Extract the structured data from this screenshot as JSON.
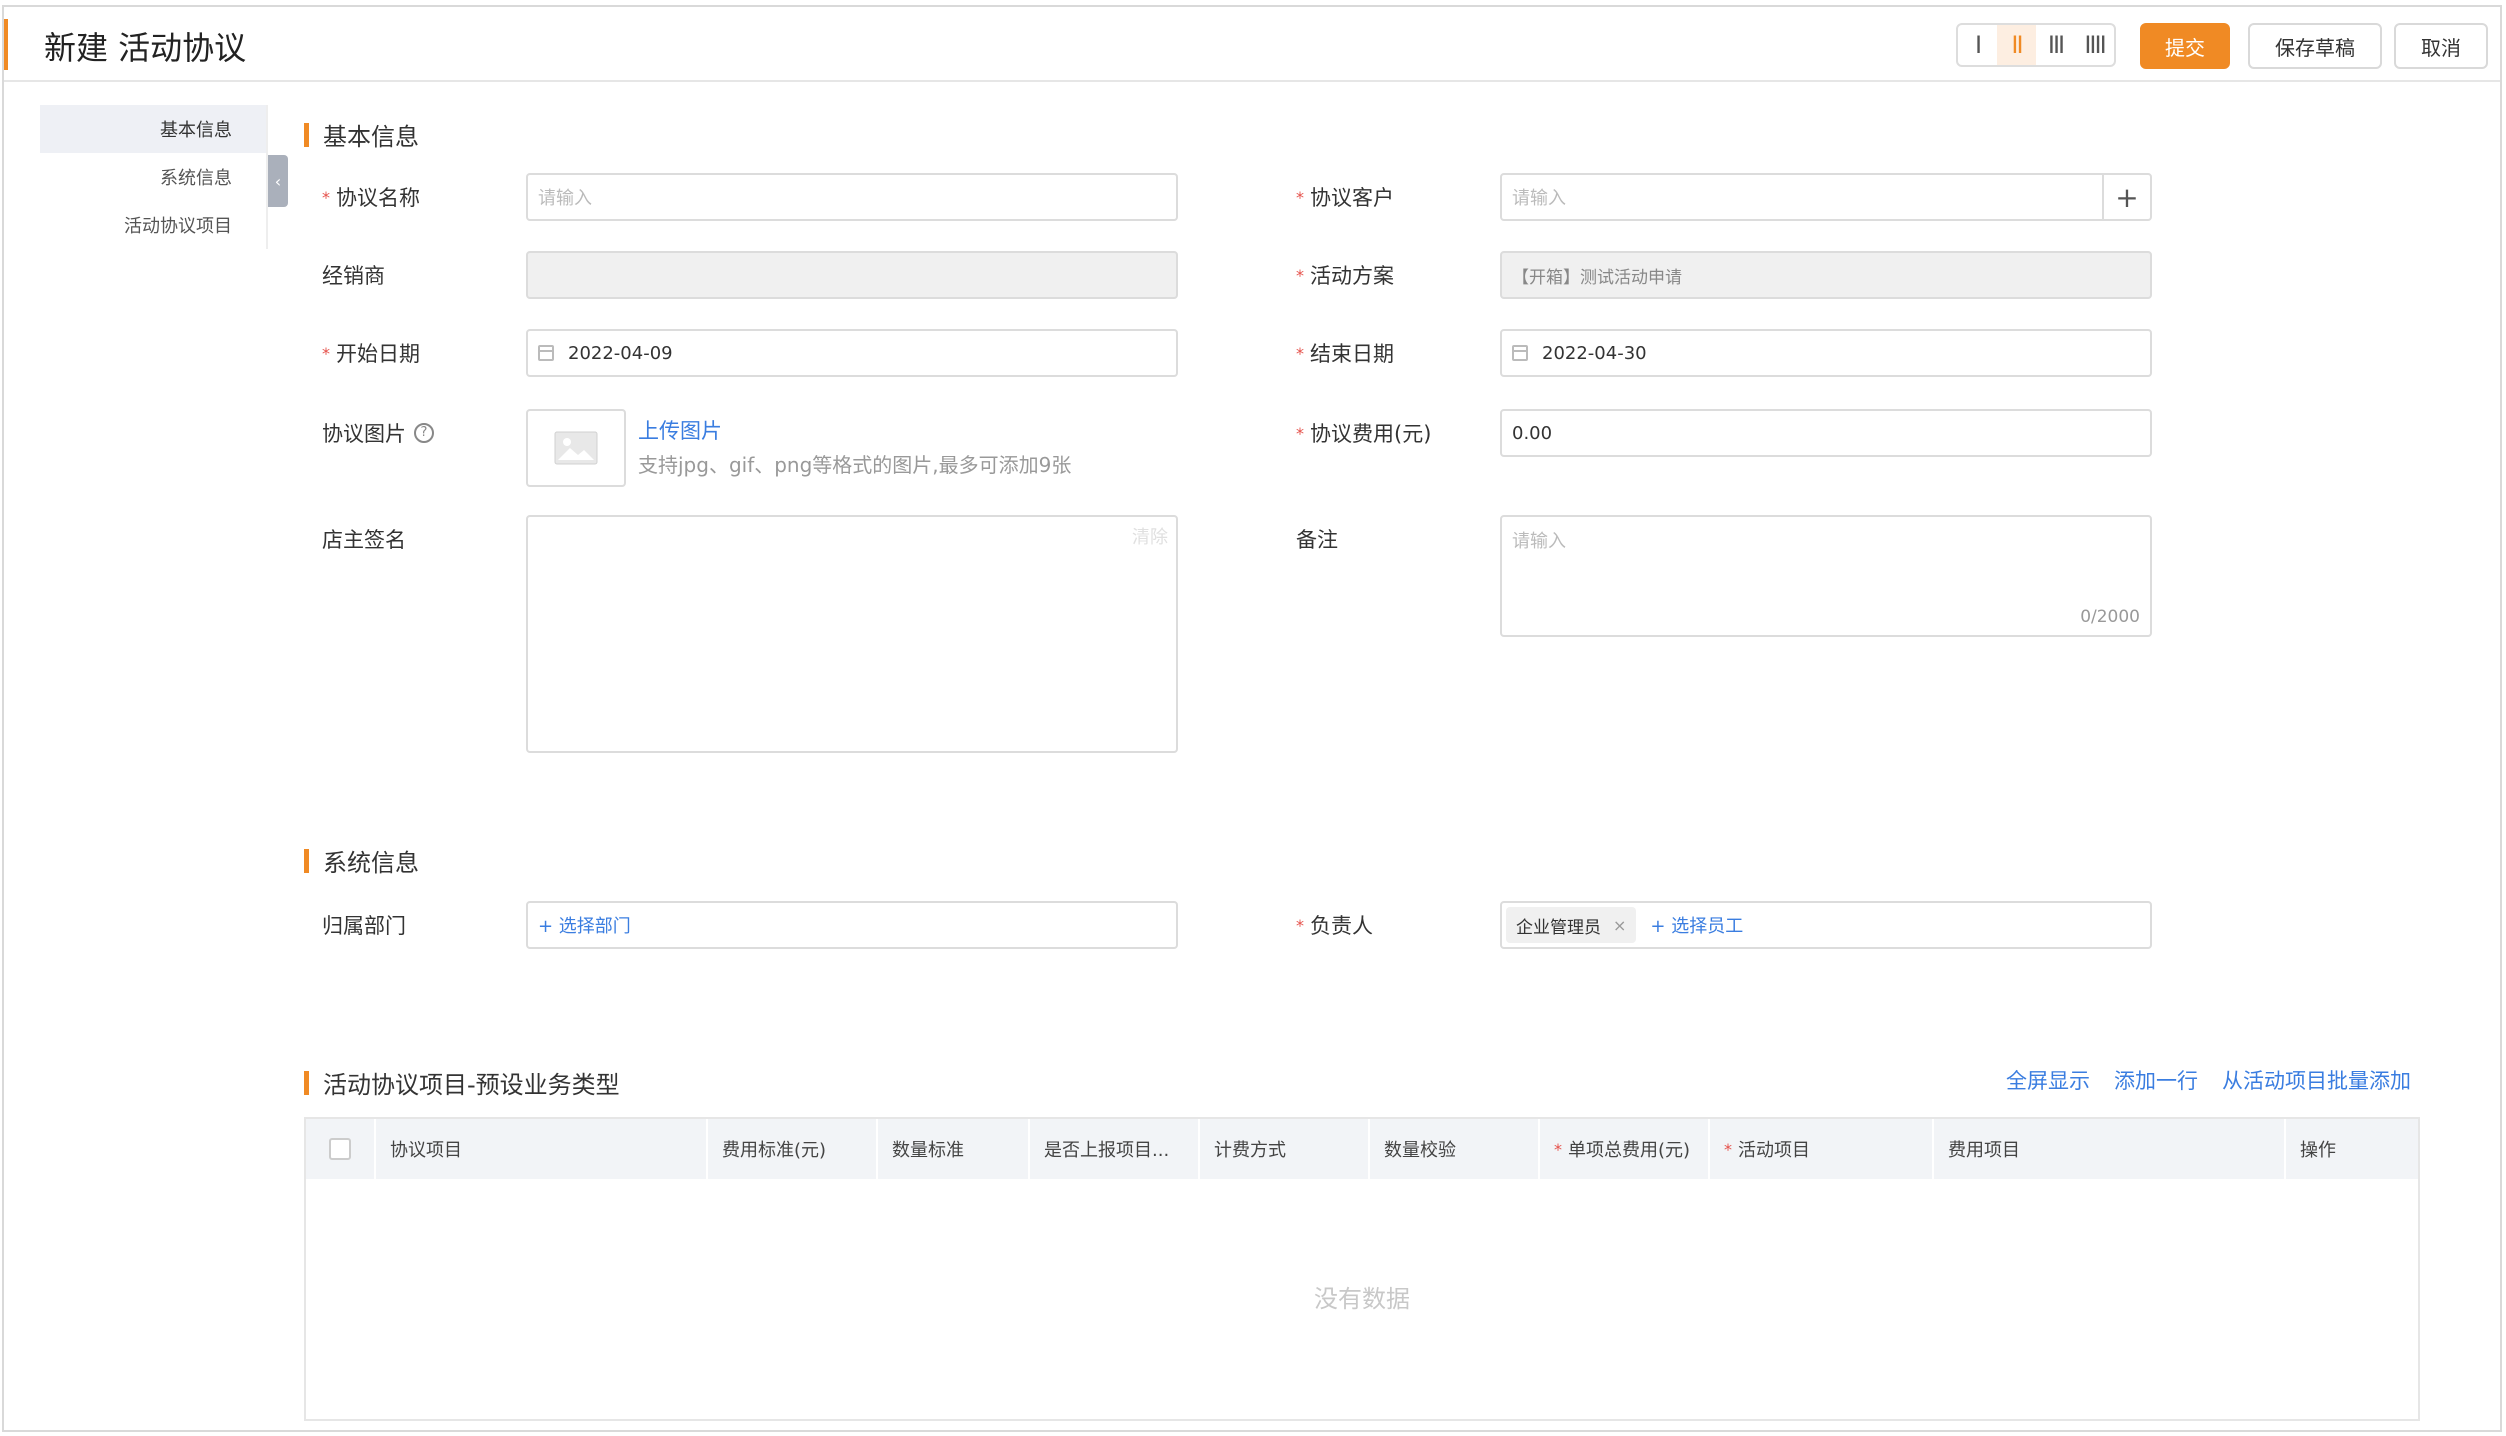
{
  "header": {
    "title": "新建 活动协议",
    "layout_options": [
      "I",
      "II",
      "III",
      "IIII"
    ],
    "submit_label": "提交",
    "save_draft_label": "保存草稿",
    "cancel_label": "取消",
    "accent_color": "#f08a24"
  },
  "sidenav": {
    "items": [
      {
        "label": "基本信息",
        "active": true
      },
      {
        "label": "系统信息",
        "active": false
      },
      {
        "label": "活动协议项目",
        "active": false
      }
    ]
  },
  "basic": {
    "section_title": "基本信息",
    "name_label": "协议名称",
    "name_placeholder": "请输入",
    "customer_label": "协议客户",
    "customer_placeholder": "请输入",
    "dealer_label": "经销商",
    "dealer_value": "",
    "plan_label": "活动方案",
    "plan_value": "【开箱】测试活动申请",
    "start_label": "开始日期",
    "start_value": "2022-04-09",
    "end_label": "结束日期",
    "end_value": "2022-04-30",
    "image_label": "协议图片",
    "upload_label": "上传图片",
    "upload_hint": "支持jpg、gif、png等格式的图片,最多可添加9张",
    "fee_label": "协议费用(元)",
    "fee_value": "0.00",
    "signature_label": "店主签名",
    "clear_label": "清除",
    "remark_label": "备注",
    "remark_placeholder": "请输入",
    "remark_count": "0/2000"
  },
  "system": {
    "section_title": "系统信息",
    "dept_label": "归属部门",
    "dept_action": "+ 选择部门",
    "owner_label": "负责人",
    "owner_tag": "企业管理员",
    "owner_action": "+ 选择员工"
  },
  "items": {
    "section_title": "活动协议项目-预设业务类型",
    "fullscreen_label": "全屏显示",
    "add_row_label": "添加一行",
    "batch_add_label": "从活动项目批量添加",
    "columns": [
      "协议项目",
      "费用标准(元)",
      "数量标准",
      "是否上报项目...",
      "计费方式",
      "数量校验",
      "单项总费用(元)",
      "活动项目",
      "费用项目",
      "操作"
    ],
    "empty_text": "没有数据"
  }
}
